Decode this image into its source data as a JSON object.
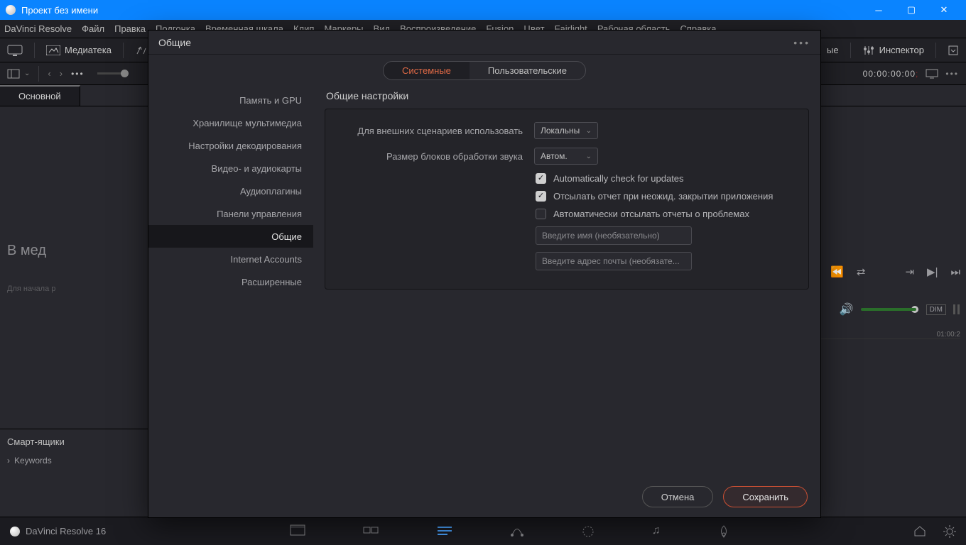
{
  "window": {
    "title": "Проект без имени"
  },
  "menubar": [
    "DaVinci Resolve",
    "Файл",
    "Правка",
    "Подгонка",
    "Временная шкала",
    "Клип",
    "Маркеры",
    "Вид",
    "Воспроизведение",
    "Fusion",
    "Цвет",
    "Fairlight",
    "Рабочая область",
    "Справка"
  ],
  "toolbar1": {
    "media": "Медиатека",
    "inspector": "Инспектор",
    "truncated": "ые"
  },
  "doctab": "Основной",
  "timecode": {
    "value": "00:00:00:00"
  },
  "left": {
    "placeholder_line1": "В мед",
    "placeholder_line2": "Для начала р",
    "smart_bins": "Смарт-ящики",
    "keywords": "Keywords"
  },
  "ruler_end": "01:00:2",
  "volume": {
    "dim": "DIM"
  },
  "bottom": {
    "app": "DaVinci Resolve 16"
  },
  "dialog": {
    "title": "Общие",
    "seg": {
      "system": "Системные",
      "user": "Пользовательские"
    },
    "sidebar": [
      "Память и GPU",
      "Хранилище мультимедиа",
      "Настройки декодирования",
      "Видео- и аудиокарты",
      "Аудиоплагины",
      "Панели управления",
      "Общие",
      "Internet Accounts",
      "Расширенные"
    ],
    "section": "Общие настройки",
    "labels": {
      "ext": "Для внешних сценариев использовать",
      "block": "Размер блоков обработки звука"
    },
    "selects": {
      "ext": "Локальны",
      "block": "Автом."
    },
    "checks": {
      "updates": "Automatically check for updates",
      "crash": "Отсылать отчет при неожид. закрытии приложения",
      "auto": "Автоматически отсылать отчеты о проблемах"
    },
    "fields": {
      "name": "Введите имя (необязательно)",
      "email": "Введите адрес почты (необязате..."
    },
    "buttons": {
      "cancel": "Отмена",
      "save": "Сохранить"
    }
  }
}
